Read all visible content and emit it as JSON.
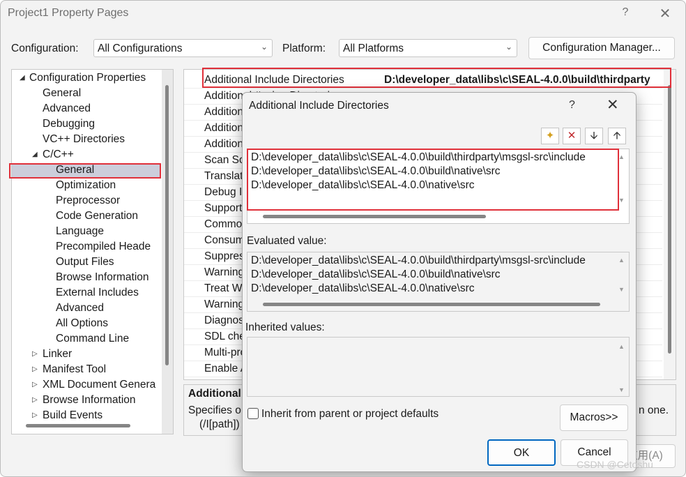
{
  "window": {
    "title": "Project1 Property Pages",
    "help": "?",
    "close": "✕"
  },
  "config_row": {
    "configuration_label": "Configuration:",
    "configuration_value": "All Configurations",
    "platform_label": "Platform:",
    "platform_value": "All Platforms",
    "manager_button": "Configuration Manager..."
  },
  "tree": {
    "items": [
      {
        "label": "Configuration Properties",
        "arrow": "◢"
      },
      {
        "label": "General"
      },
      {
        "label": "Advanced"
      },
      {
        "label": "Debugging"
      },
      {
        "label": "VC++ Directories"
      },
      {
        "label": "C/C++",
        "arrow": "◢"
      },
      {
        "label": "General",
        "selected": true
      },
      {
        "label": "Optimization"
      },
      {
        "label": "Preprocessor"
      },
      {
        "label": "Code Generation"
      },
      {
        "label": "Language"
      },
      {
        "label": "Precompiled Heade"
      },
      {
        "label": "Output Files"
      },
      {
        "label": "Browse Information"
      },
      {
        "label": "External Includes"
      },
      {
        "label": "Advanced"
      },
      {
        "label": "All Options"
      },
      {
        "label": "Command Line"
      },
      {
        "label": "Linker",
        "arrow": "▷"
      },
      {
        "label": "Manifest Tool",
        "arrow": "▷"
      },
      {
        "label": "XML Document Genera",
        "arrow": "▷"
      },
      {
        "label": "Browse Information",
        "arrow": "▷"
      },
      {
        "label": "Build Events",
        "arrow": "▷"
      }
    ]
  },
  "properties": {
    "rows": [
      {
        "name": "Additional Include Directories",
        "value": "D:\\developer_data\\libs\\c\\SEAL-4.0.0\\build\\thirdparty"
      },
      {
        "name": "Additional #using Directories"
      },
      {
        "name": "Additional BMI Directories"
      },
      {
        "name": "Additional Module Dependencies"
      },
      {
        "name": "Additional Header Unit Dependencies"
      },
      {
        "name": "Scan Sources for Module Dependencies"
      },
      {
        "name": "Translate Includes to Imports"
      },
      {
        "name": "Debug Information Format"
      },
      {
        "name": "Support Just My Code Debugging"
      },
      {
        "name": "Common Language RunTime Support"
      },
      {
        "name": "Consume Windows Runtime Extension"
      },
      {
        "name": "Suppress Startup Banner"
      },
      {
        "name": "Warning Level"
      },
      {
        "name": "Treat Warnings As Errors"
      },
      {
        "name": "Warning Version"
      },
      {
        "name": "Diagnostics Format"
      },
      {
        "name": "SDL checks"
      },
      {
        "name": "Multi-processor Compilation"
      },
      {
        "name": "Enable Address Sanitizer"
      }
    ]
  },
  "description": {
    "title": "Additional",
    "text": "Specifies o",
    "text_tail": "n one.",
    "syntax": "(/I[path])"
  },
  "apply_button": "应用(A)",
  "dialog": {
    "title": "Additional Include Directories",
    "help": "?",
    "close": "✕",
    "toolbar": {
      "new_line": "✦",
      "delete": "✕",
      "move_down": "🡫",
      "move_up": "🡩"
    },
    "entries": [
      "D:\\developer_data\\libs\\c\\SEAL-4.0.0\\build\\thirdparty\\msgsl-src\\include",
      "D:\\developer_data\\libs\\c\\SEAL-4.0.0\\build\\native\\src",
      "D:\\developer_data\\libs\\c\\SEAL-4.0.0\\native\\src"
    ],
    "evaluated_label": "Evaluated value:",
    "evaluated": [
      "D:\\developer_data\\libs\\c\\SEAL-4.0.0\\build\\thirdparty\\msgsl-src\\include",
      "D:\\developer_data\\libs\\c\\SEAL-4.0.0\\build\\native\\src",
      "D:\\developer_data\\libs\\c\\SEAL-4.0.0\\native\\src"
    ],
    "inherited_label": "Inherited values:",
    "inherit_checkbox": "Inherit from parent or project defaults",
    "macros_button": "Macros>>",
    "ok_button": "OK",
    "cancel_button": "Cancel"
  },
  "watermark": "CSDN @Cetoshu",
  "colors": {
    "highlight_box": "#e0303a",
    "tree_selection": "#cccedb",
    "focus_border": "#0067c0"
  }
}
